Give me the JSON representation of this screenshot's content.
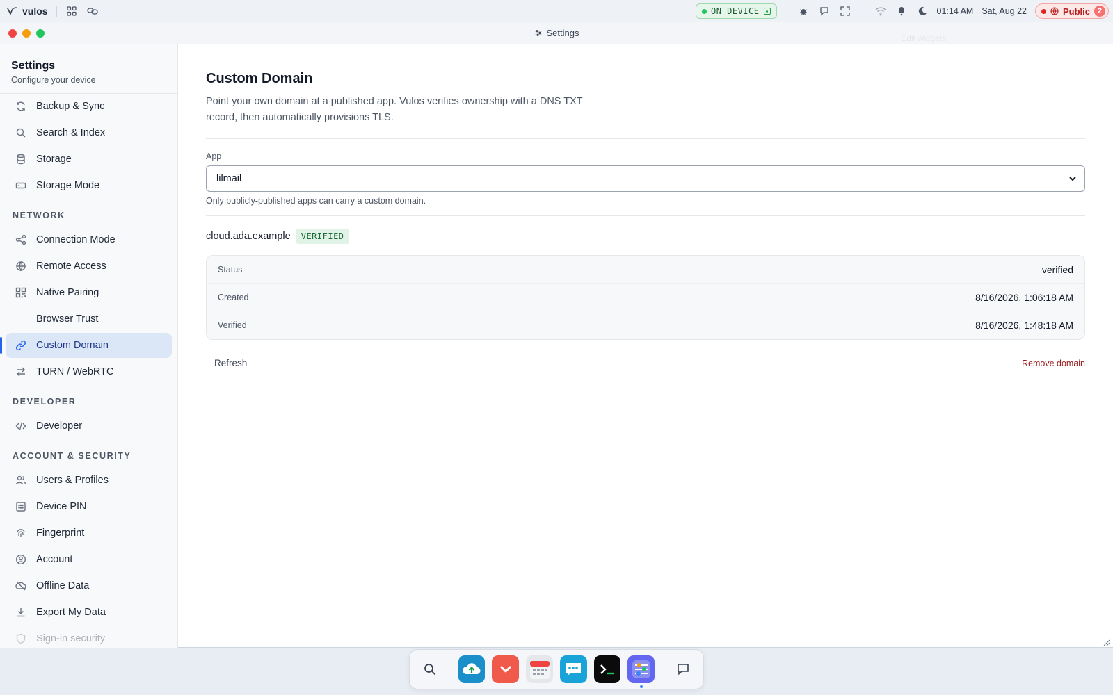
{
  "topbar": {
    "brand": "vulos",
    "on_device": "ON DEVICE",
    "time": "01:14 AM",
    "date": "Sat, Aug 22",
    "public_label": "Public",
    "public_count": "2"
  },
  "window": {
    "title": "Settings",
    "edit_widgets": "Edit widgets"
  },
  "sidebar": {
    "title": "Settings",
    "subtitle": "Configure your device",
    "items_top": [
      {
        "label": "Backup & Sync",
        "icon": "sync-icon"
      },
      {
        "label": "Search & Index",
        "icon": "search-icon"
      },
      {
        "label": "Storage",
        "icon": "database-icon"
      },
      {
        "label": "Storage Mode",
        "icon": "drive-icon"
      }
    ],
    "section_network": "NETWORK",
    "items_network": [
      {
        "label": "Connection Mode",
        "icon": "share-nodes-icon"
      },
      {
        "label": "Remote Access",
        "icon": "globe-icon"
      },
      {
        "label": "Native Pairing",
        "icon": "qr-icon"
      },
      {
        "label": "Browser Trust",
        "icon": ""
      },
      {
        "label": "Custom Domain",
        "icon": "link-icon"
      },
      {
        "label": "TURN / WebRTC",
        "icon": "swap-arrows-icon"
      }
    ],
    "section_developer": "DEVELOPER",
    "items_developer": [
      {
        "label": "Developer",
        "icon": "code-icon"
      }
    ],
    "section_account": "ACCOUNT & SECURITY",
    "items_account": [
      {
        "label": "Users & Profiles",
        "icon": "users-icon"
      },
      {
        "label": "Device PIN",
        "icon": "keypad-icon"
      },
      {
        "label": "Fingerprint",
        "icon": "fingerprint-icon"
      },
      {
        "label": "Account",
        "icon": "user-circle-icon"
      },
      {
        "label": "Offline Data",
        "icon": "cloud-off-icon"
      },
      {
        "label": "Export My Data",
        "icon": "download-icon"
      },
      {
        "label": "Sign-in security",
        "icon": "shield-icon"
      }
    ]
  },
  "main": {
    "title": "Custom Domain",
    "description": "Point your own domain at a published app. Vulos verifies ownership with a DNS TXT record, then automatically provisions TLS.",
    "app_label": "App",
    "app_selected": "lilmail",
    "app_hint": "Only publicly-published apps can carry a custom domain.",
    "domain": "cloud.ada.example",
    "domain_badge": "VERIFIED",
    "details": [
      {
        "key": "Status",
        "value": "verified"
      },
      {
        "key": "Created",
        "value": "8/16/2026, 1:06:18 AM"
      },
      {
        "key": "Verified",
        "value": "8/16/2026, 1:48:18 AM"
      }
    ],
    "refresh_label": "Refresh",
    "remove_label": "Remove domain"
  },
  "colors": {
    "accent": "#2563eb",
    "active_bg": "#dbe6f7",
    "verified_bg": "#e1f3e6",
    "danger": "#991b1b"
  }
}
